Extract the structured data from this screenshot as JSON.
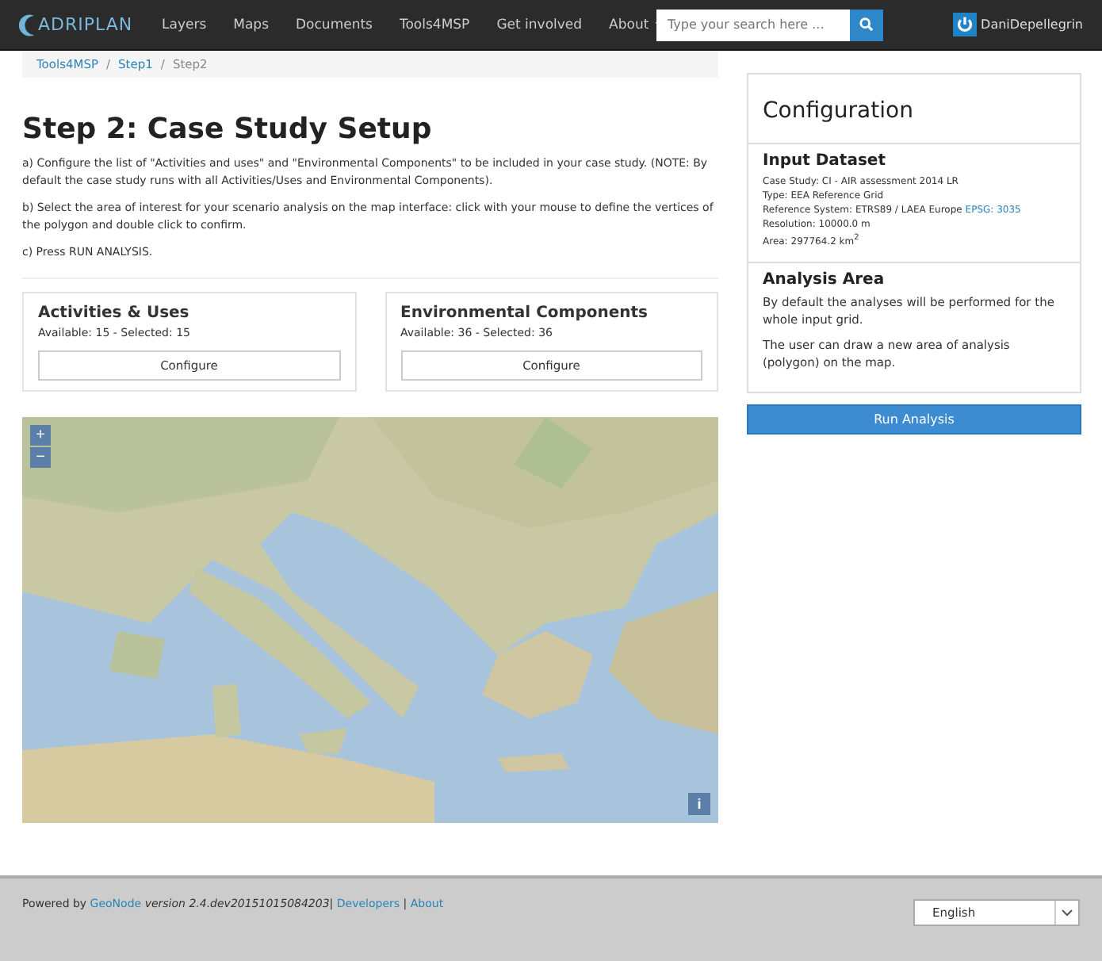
{
  "navbar": {
    "logo": "ADRIPLAN",
    "items": [
      {
        "label": "Layers",
        "dropdown": false
      },
      {
        "label": "Maps",
        "dropdown": false
      },
      {
        "label": "Documents",
        "dropdown": false
      },
      {
        "label": "Tools4MSP",
        "dropdown": false
      },
      {
        "label": "Get involved",
        "dropdown": false
      },
      {
        "label": "About",
        "dropdown": true
      }
    ],
    "search": {
      "placeholder": "Type your search here ..."
    },
    "user": "DaniDepellegrin"
  },
  "breadcrumb_separator": "/",
  "breadcrumb": [
    {
      "label": "Tools4MSP",
      "selected": false
    },
    {
      "label": "Step1",
      "selected": false
    },
    {
      "label": "Step2",
      "selected": true
    }
  ],
  "title": "Step 2: Case Study Setup",
  "instructions": [
    "a) Configure the list of \"Activities and uses\" and \"Environmental Components\" to be included in your case study. (NOTE: By default the case study runs with all Activities/Uses and Environmental Components).",
    "b) Select the area of interest for your scenario analysis on the map interface: click with your mouse to define the vertices of the polygon and double click to confirm.",
    "c) Press RUN ANALYSIS."
  ],
  "cards": [
    {
      "title": "Activities & Uses",
      "counts": "Available: 15 - Selected: 15",
      "button": "Configure"
    },
    {
      "title": "Environmental Components",
      "counts": "Available: 36 - Selected: 36",
      "button": "Configure"
    }
  ],
  "map": {
    "kind": "picture",
    "zoom_in": "+",
    "zoom_out": "−",
    "info": "i"
  },
  "configuration": {
    "title": "Configuration",
    "input_dataset": {
      "heading": "Input Dataset",
      "fields": [
        {
          "label": "Case Study:",
          "value": "CI - AIR assessment 2014 LR"
        },
        {
          "label": "Type:",
          "value": "EEA Reference Grid"
        },
        {
          "label": "Reference System:",
          "value": "ETRS89 / LAEA Europe",
          "link": "EPSG: 3035"
        },
        {
          "label": "Resolution:",
          "value": "10000.0 m"
        },
        {
          "label": "Area:",
          "value": "297764.2 km$^{2}$"
        }
      ]
    },
    "analysis_area": {
      "heading": "Analysis Area",
      "paragraphs": [
        "By default the analyses will be performed for the whole input grid.",
        "The user can draw a new area of analysis (polygon) on the map."
      ]
    },
    "button": "Run Analysis"
  },
  "footer": {
    "powered": "Powered by",
    "geonode": "GeoNode",
    "version": "version 2.4.dev20151015084203",
    "separator": "|",
    "links": [
      "Developers",
      "About"
    ],
    "language": "English"
  }
}
